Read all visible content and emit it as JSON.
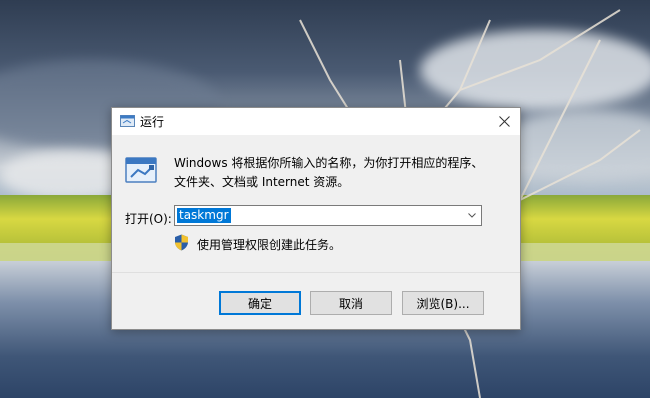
{
  "dialog": {
    "title": "运行",
    "close_icon": "close-icon",
    "description": "Windows 将根据你所输入的名称，为你打开相应的程序、文件夹、文档或 Internet 资源。",
    "open_label": "打开(O):",
    "open_value": "taskmgr",
    "admin_text": "使用管理权限创建此任务。",
    "buttons": {
      "ok": "确定",
      "cancel": "取消",
      "browse": "浏览(B)..."
    }
  },
  "colors": {
    "accent": "#0078d7",
    "dialog_bg": "#f0f0f0",
    "titlebar_bg": "#ffffff"
  }
}
